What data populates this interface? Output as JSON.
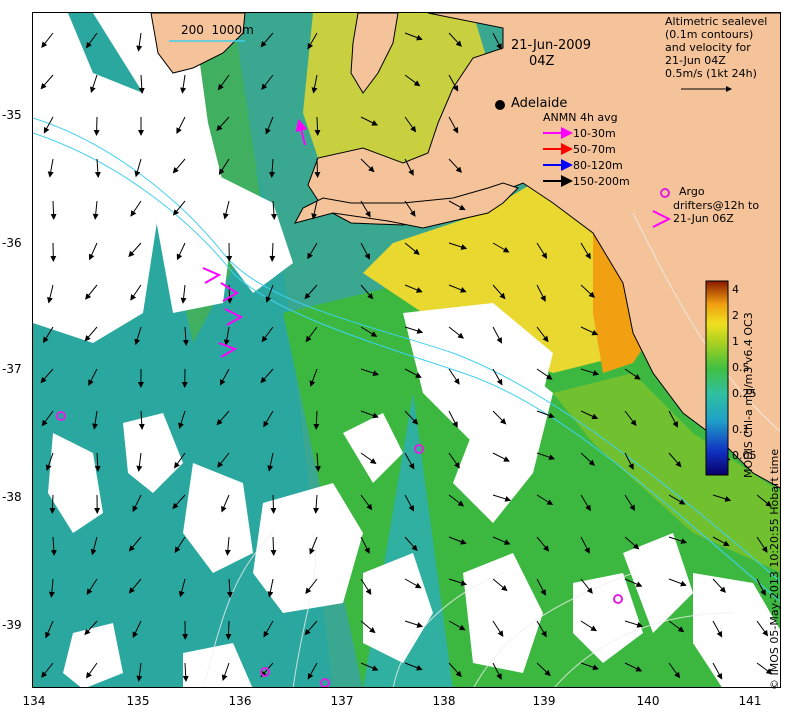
{
  "map": {
    "date": "21-Jun-2009",
    "time": "04Z",
    "scale_bar_label": "200  1000m",
    "city": "Adelaide",
    "legend_title": "Altimetric sealevel\n(0.1m contours)\nand velocity for\n21-Jun 04Z\n0.5m/s (1kt 24h)",
    "anmn_title": "ANMN 4h avg",
    "anmn_items": [
      {
        "label": "10-30m",
        "color": "#ff00ff"
      },
      {
        "label": "50-70m",
        "color": "#ff0000"
      },
      {
        "label": "80-120m",
        "color": "#0000ff"
      },
      {
        "label": "150-200m",
        "color": "#000000"
      }
    ],
    "argo_label": "Argo",
    "drifter_label": "drifters@12h to\n21-Jun 06Z",
    "argo_color": "#e020e0",
    "land_color": "#f5c39a",
    "cloud_color": "#ffffff"
  },
  "axes": {
    "longitude_ticks": [
      "134",
      "135",
      "136",
      "137",
      "138",
      "139",
      "140",
      "141"
    ],
    "latitude_ticks": [
      "-35",
      "-36",
      "-37",
      "-38",
      "-39"
    ]
  },
  "colorbar": {
    "title": "MODIS Chl-a mg/m3 v6.4 OC3",
    "ticks": [
      "4",
      "2",
      "1",
      "0.5",
      "0.25",
      "0.1",
      "0.05"
    ],
    "scale": "log",
    "range": [
      0.03,
      5
    ]
  },
  "credit": "© IMOS 05-May-2013 10:20:55 Hobart time"
}
